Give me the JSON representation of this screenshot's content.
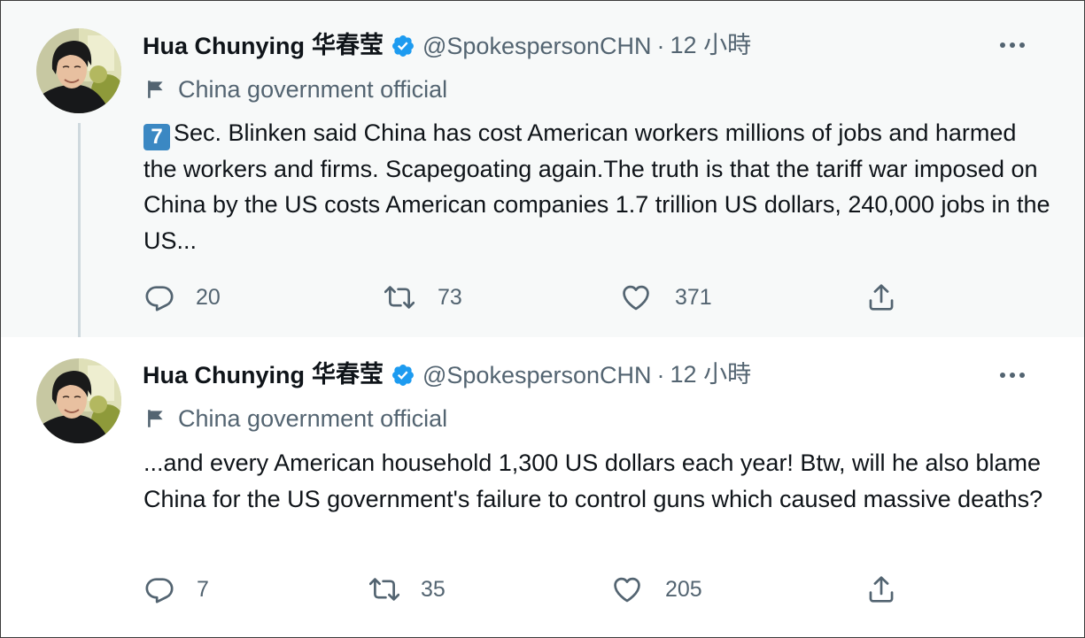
{
  "tweets": [
    {
      "author_name": "Hua Chunying",
      "author_name_cjk": "华春莹",
      "handle": "@SpokespersonCHN",
      "separator": "·",
      "time_num": "12",
      "time_unit": "小時",
      "label": "China government official",
      "keycap": "7",
      "text": "Sec. Blinken said China has cost American workers millions of jobs and harmed the workers and firms. Scapegoating again.The truth is that the tariff war imposed on China by the US costs American companies 1.7 trillion US dollars, 240,000 jobs in the US...",
      "replies": "20",
      "retweets": "73",
      "likes": "371"
    },
    {
      "author_name": "Hua Chunying",
      "author_name_cjk": "华春莹",
      "handle": "@SpokespersonCHN",
      "separator": "·",
      "time_num": "12",
      "time_unit": "小時",
      "label": "China government official",
      "text": "...and every American household 1,300 US dollars each year! Btw, will he also blame China for the US government's failure to control guns which caused massive deaths?",
      "replies": "7",
      "retweets": "35",
      "likes": "205"
    }
  ],
  "colors": {
    "verified": "#1d9bf0",
    "muted": "#536471",
    "text": "#0f1419",
    "hover_bg": "#f7f9f9",
    "thread_line": "#cfd9de"
  },
  "icons": [
    "verified-badge-icon",
    "more-icon",
    "flag-icon",
    "reply-icon",
    "retweet-icon",
    "like-icon",
    "share-icon"
  ]
}
